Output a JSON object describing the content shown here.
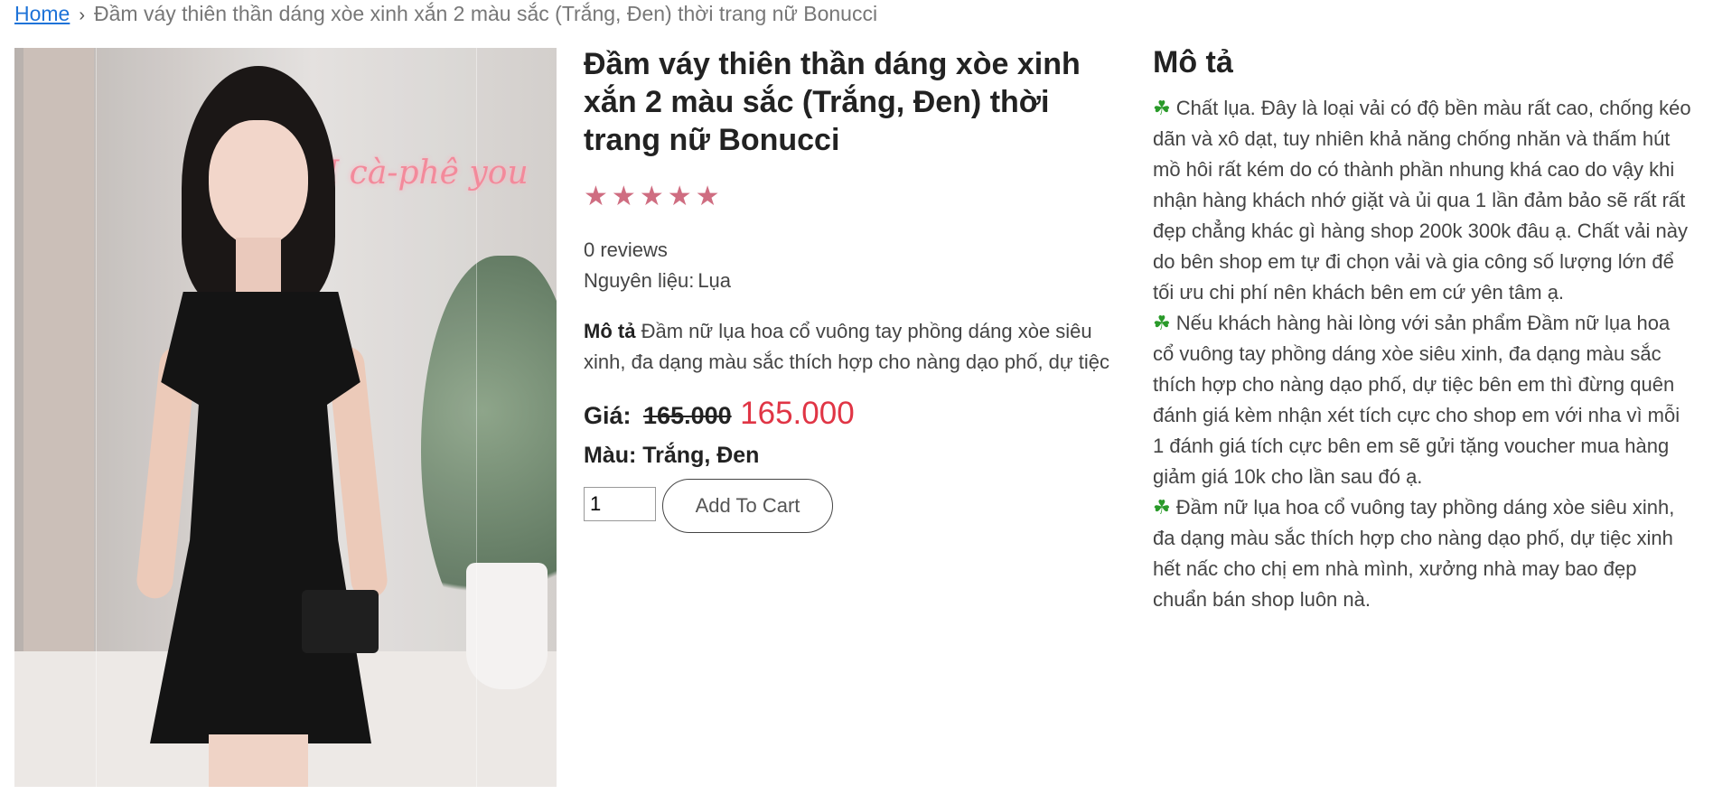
{
  "breadcrumb": {
    "home": "Home",
    "current": "Đầm váy thiên thần dáng xòe xinh xắn 2 màu sắc (Trắng, Đen) thời trang nữ Bonucci"
  },
  "product": {
    "title": "Đầm váy thiên thần dáng xòe xinh xắn 2 màu sắc (Trắng, Đen) thời trang nữ Bonucci",
    "rating_stars": 5,
    "reviews": "0 reviews",
    "material_label": "Nguyên liệu:",
    "material_value": "Lụa",
    "short_desc_label": "Mô tả",
    "short_desc": "Đầm nữ lụa hoa cổ vuông tay phồng dáng xòe siêu xinh, đa dạng màu sắc thích hợp cho nàng dạo phố, dự tiệc",
    "price_label": "Giá:",
    "price_old": "165.000",
    "price_new": "165.000",
    "color_text": "Màu: Trắng, Đen",
    "quantity": "1",
    "add_to_cart": "Add To Cart",
    "image_neon_text": "I cà-phê you"
  },
  "description": {
    "heading": "Mô tả",
    "paragraphs": [
      "Chất lụa. Đây là loại vải có độ bền màu rất cao, chống kéo dãn và xô dạt, tuy nhiên khả năng chống nhăn và thấm hút mồ hôi rất kém do có thành phần nhung khá cao do vậy khi nhận hàng khách nhớ giặt và ủi qua 1 lần đảm bảo sẽ rất rất đẹp chẳng khác gì hàng shop 200k 300k đâu ạ. Chất vải này do bên shop em tự đi chọn vải và gia công số lượng lớn để tối ưu chi phí nên khách bên em cứ yên tâm ạ.",
      "Nếu khách hàng hài lòng với sản phẩm Đầm nữ lụa hoa cổ vuông tay phồng dáng xòe siêu xinh, đa dạng màu sắc thích hợp cho nàng dạo phố, dự tiệc bên em thì đừng quên đánh giá kèm nhận xét tích cực cho shop em với nha vì mỗi 1 đánh giá tích cực bên em sẽ gửi tặng voucher mua hàng giảm giá 10k cho lần sau đó ạ.",
      "Đầm nữ lụa hoa cổ vuông tay phồng dáng xòe siêu xinh, đa dạng màu sắc thích hợp cho nàng dạo phố, dự tiệc xinh hết nấc cho chị em nhà mình, xưởng nhà may bao đẹp chuẩn bán shop luôn nà."
    ]
  },
  "colors": {
    "star": "#cf6d81",
    "price_new": "#e03545",
    "link": "#1e73d8"
  },
  "icons": {
    "breadcrumb_separator": "chevron-right-icon",
    "bullet": "clover-icon",
    "rating": "star-icon"
  }
}
